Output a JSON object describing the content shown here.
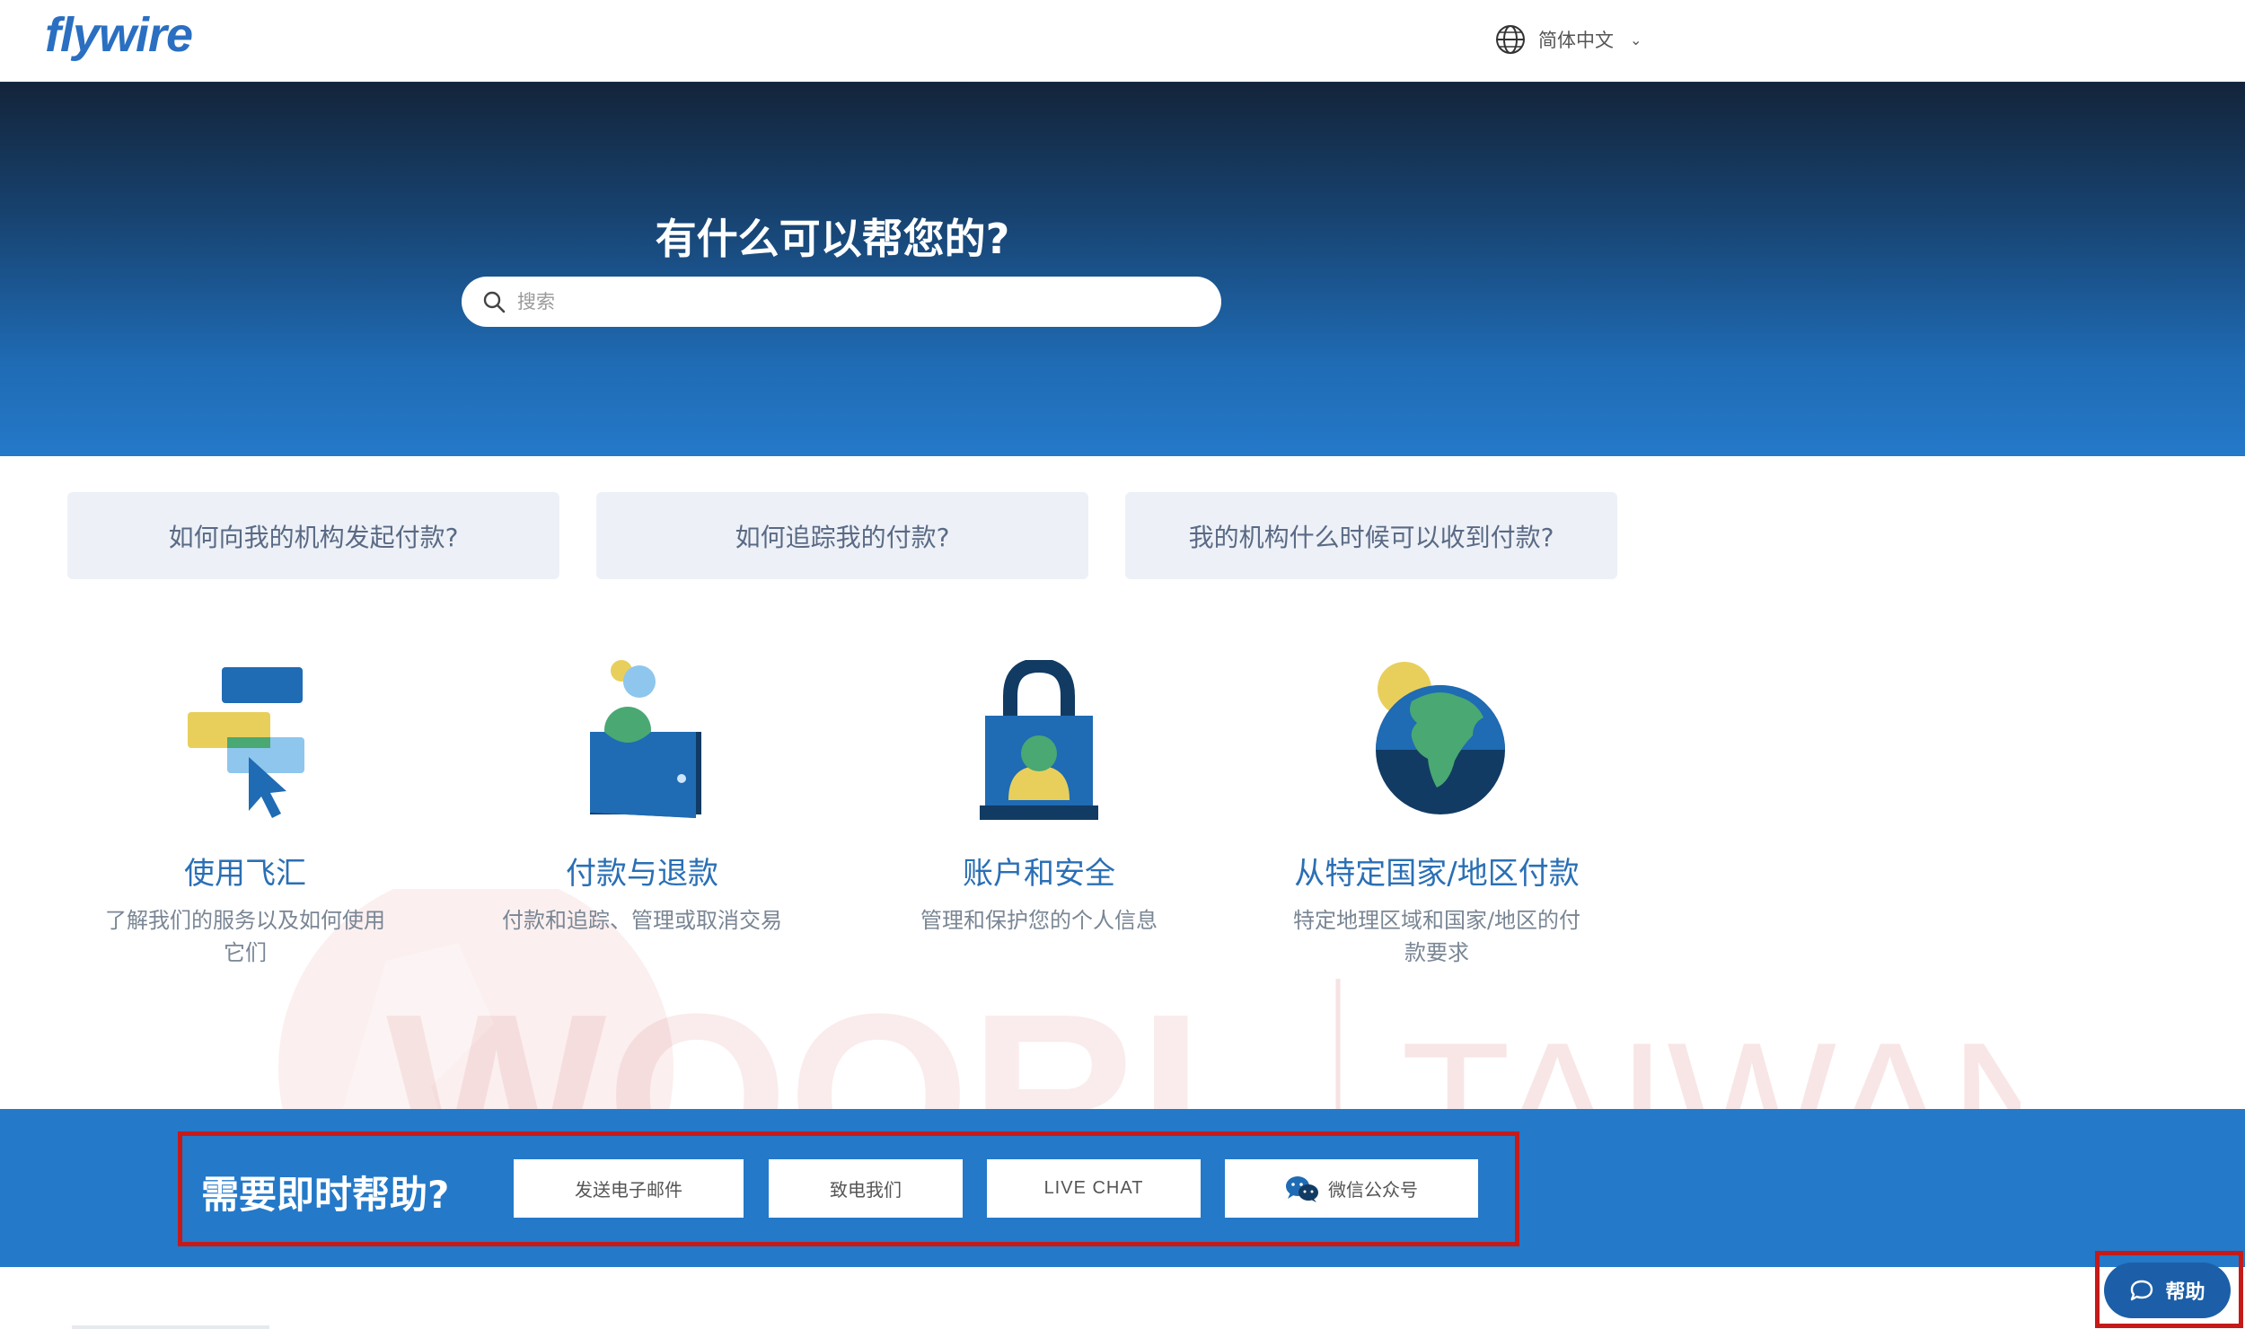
{
  "header": {
    "logo_text": "flywire",
    "language": {
      "icon": "globe-icon",
      "label": "简体中文"
    }
  },
  "hero": {
    "title": "有什么可以帮您的?",
    "search_placeholder": "搜索"
  },
  "quick_questions": [
    "如何向我的机构发起付款?",
    "如何追踪我的付款?",
    "我的机构什么时候可以收到付款?"
  ],
  "categories": [
    {
      "icon": "flywire-usage-icon",
      "title": "使用飞汇",
      "desc": "了解我们的服务以及如何使用它们"
    },
    {
      "icon": "wallet-icon",
      "title": "付款与退款",
      "desc": "付款和追踪、管理或取消交易"
    },
    {
      "icon": "lock-icon",
      "title": "账户和安全",
      "desc": "管理和保护您的个人信息"
    },
    {
      "icon": "globe-earth-icon",
      "title": "从特定国家/地区付款",
      "desc": "特定地理区域和国家/地区的付款要求"
    }
  ],
  "watermark": {
    "brand": "WOORI",
    "region": "TAIWAN"
  },
  "help_band": {
    "title": "需要即时帮助?",
    "buttons": [
      {
        "label": "发送电子邮件"
      },
      {
        "label": "致电我们"
      },
      {
        "label": "LIVE CHAT"
      },
      {
        "label": "微信公众号",
        "icon": "wechat-icon"
      }
    ]
  },
  "floating_help": {
    "label": "帮助",
    "icon": "chat-bubble-icon"
  },
  "colors": {
    "brand_blue": "#2479c9",
    "highlight_red": "#c51a1a",
    "text_blue": "#2a6fb5"
  }
}
